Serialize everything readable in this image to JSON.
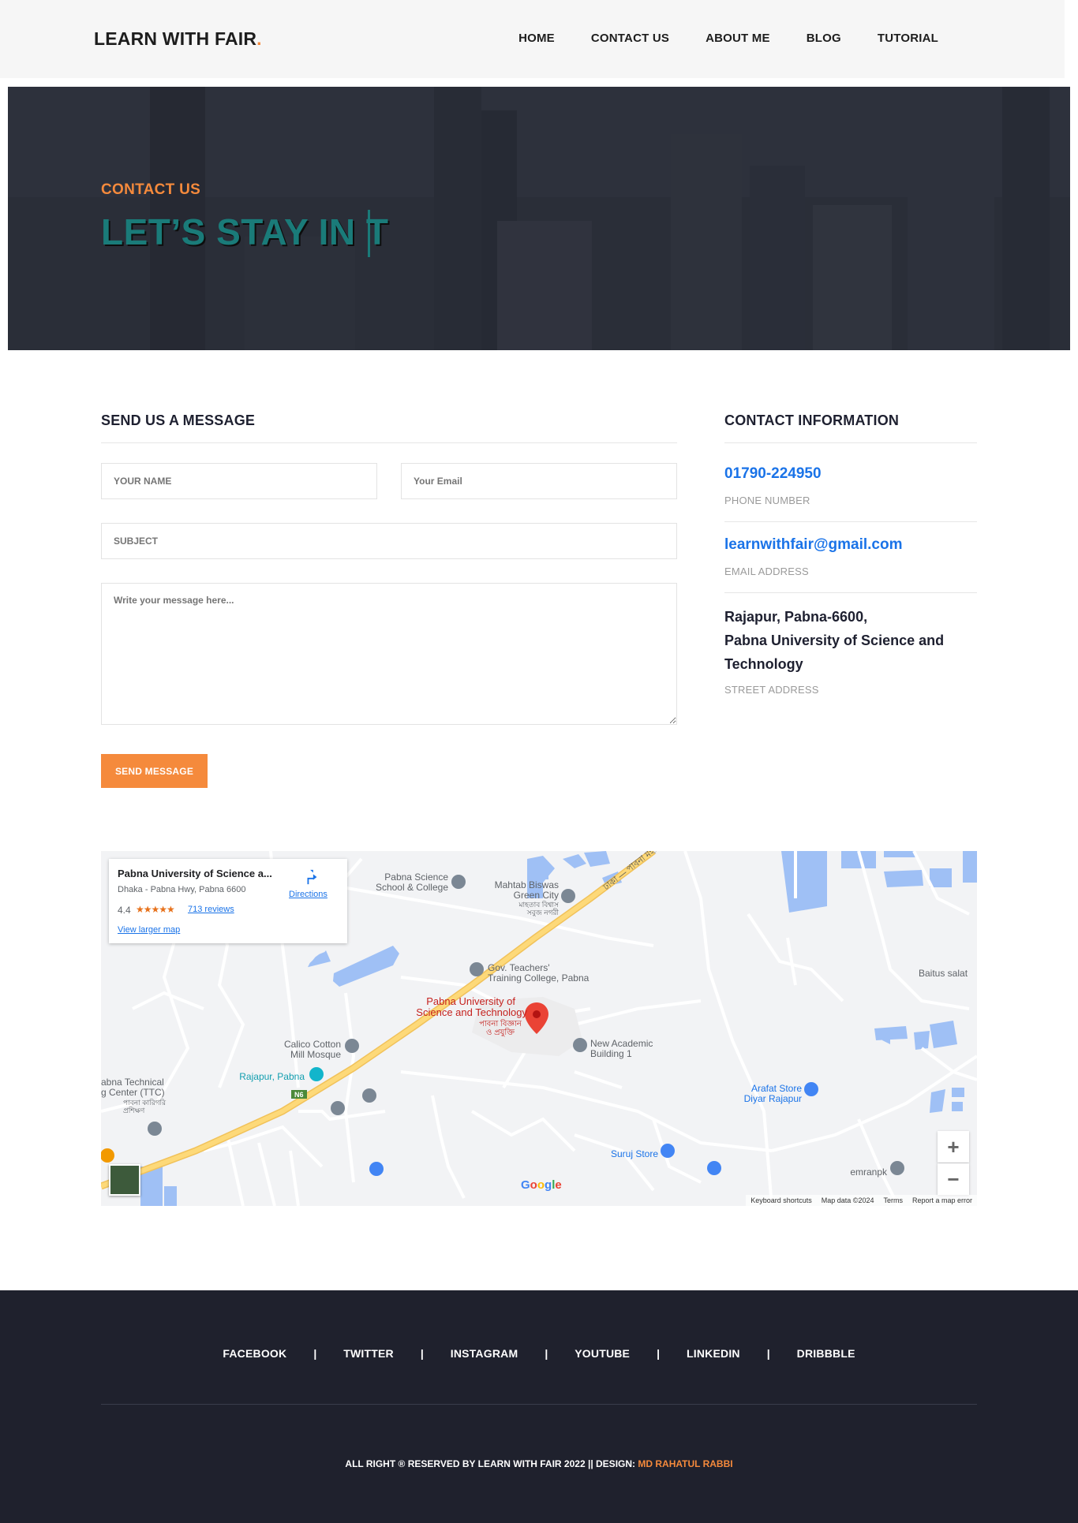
{
  "header": {
    "logo": "LEARN WITH FAIR",
    "logo_dot": ".",
    "nav": [
      "HOME",
      "CONTACT US",
      "ABOUT ME",
      "BLOG",
      "TUTORIAL"
    ]
  },
  "hero": {
    "kicker": "CONTACT US",
    "title": "LET’S STAY IN T"
  },
  "form": {
    "title": "SEND US A MESSAGE",
    "name_placeholder": "YOUR NAME",
    "email_placeholder": "Your Email",
    "subject_placeholder": "SUBJECT",
    "message_placeholder": "Write your message here...",
    "submit_label": "SEND MESSAGE"
  },
  "contact": {
    "title": "CONTACT INFORMATION",
    "phone": "01790-224950",
    "phone_label": "PHONE NUMBER",
    "email": "learnwithfair@gmail.com",
    "email_label": "EMAIL ADDRESS",
    "address_line1": "Rajapur, Pabna-6600,",
    "address_line2": "Pabna University of Science and",
    "address_line3": "Technology",
    "address_label": "STREET ADDRESS"
  },
  "map": {
    "place_name": "Pabna University of Science a...",
    "place_address": "Dhaka - Pabna Hwy, Pabna 6600",
    "rating": "4.4",
    "stars": "★★★★★",
    "reviews": "713 reviews",
    "directions": "Directions",
    "larger_map": "View larger map",
    "zoom_in": "+",
    "zoom_out": "−",
    "google": "Google",
    "footer_links": [
      "Keyboard shortcuts",
      "Map data ©2024",
      "Terms",
      "Report a map error"
    ],
    "labels": {
      "pust": "Pabna University of",
      "pust2": "Science and Technology",
      "pust_bn1": "পাবনা বিজ্ঞান",
      "pust_bn2": "ও প্রযুক্তি",
      "science_school": "Pabna Science",
      "science_school2": "School & College",
      "mahtab": "Mahtab Biswas",
      "mahtab2": "Green City",
      "mahtab_bn1": "মাহতাব বিশ্বাস",
      "mahtab_bn2": "সবুজ নগরী",
      "gov": "Gov. Teachers'",
      "gov2": "Training College, Pabna",
      "baitus": "Baitus salat",
      "new_academic": "New Academic",
      "new_academic2": "Building 1",
      "calico": "Calico Cotton",
      "calico2": "Mill Mosque",
      "rajapur": "Rajapur, Pabna",
      "ttc": "abna Technical",
      "ttc2": "g Center (TTC)",
      "ttc_bn1": "পাবনা কারিগরি",
      "ttc_bn2": "প্রশিক্ষণ",
      "arafat": "Arafat Store",
      "arafat2": "Diyar Rajapur",
      "suruj": "Suruj Store",
      "emranpk": "emranpk",
      "road": "ঢাকা — পাবনা মহাসড়ক",
      "n6": "N6"
    }
  },
  "footer": {
    "social": [
      "FACEBOOK",
      "TWITTER",
      "INSTAGRAM",
      "YOUTUBE",
      "LINKEDIN",
      "DRIBBBLE"
    ],
    "separator": "|",
    "copyright": "ALL RIGHT ® RESERVED BY LEARN WITH FAIR 2022 || DESIGN: ",
    "designer": "MD RAHATUL RABBI"
  },
  "colors": {
    "accent": "#f58a3c",
    "link_blue": "#1a73e8",
    "teal_title": "#1a7b79",
    "footer_bg": "#1f212d"
  }
}
